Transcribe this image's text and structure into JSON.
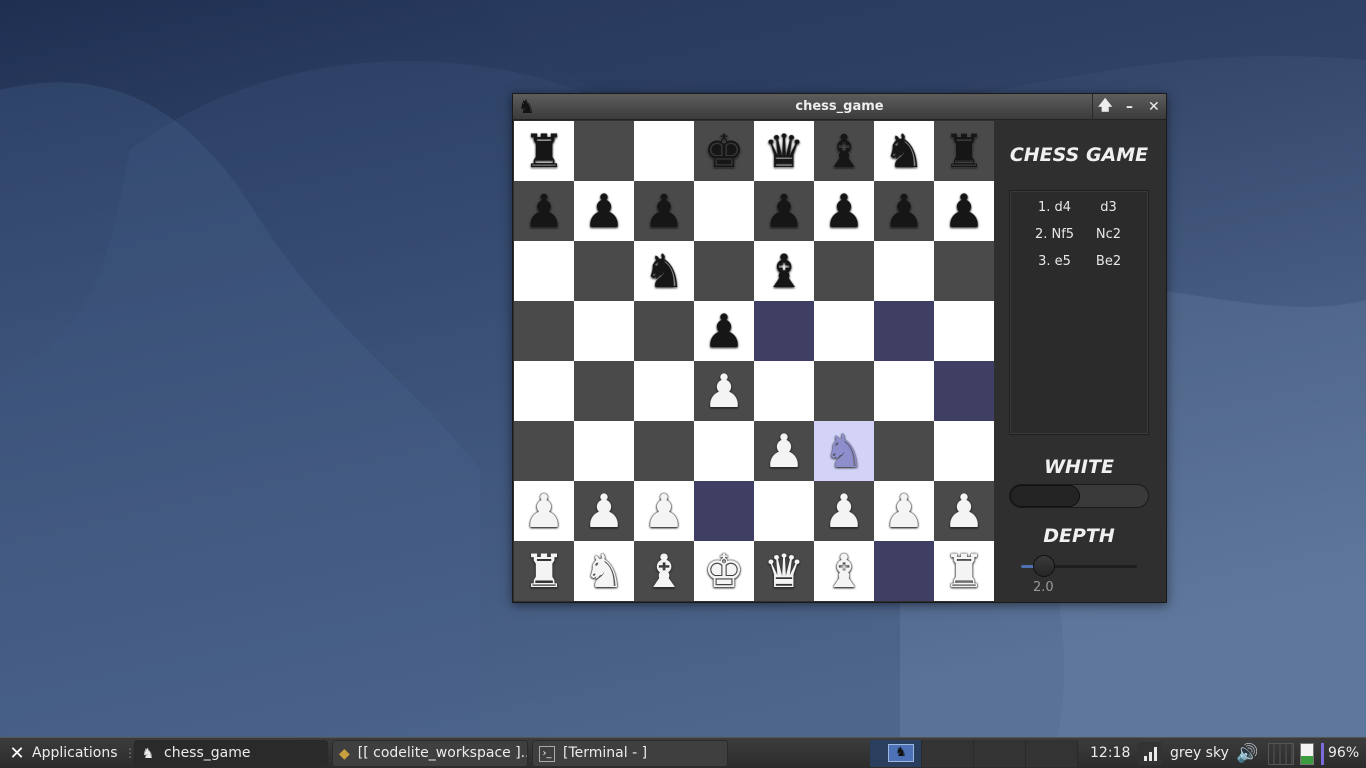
{
  "window": {
    "title": "chess_game",
    "buttons": {
      "maximize": "🡅",
      "minimize": "–",
      "close": "✕"
    }
  },
  "board": {
    "rows": [
      [
        {
          "piece": "♜",
          "color": "b",
          "bg": "light"
        },
        {
          "piece": "",
          "color": "",
          "bg": "dark"
        },
        {
          "piece": "",
          "color": "",
          "bg": "light"
        },
        {
          "piece": "♚",
          "color": "b",
          "bg": "dark"
        },
        {
          "piece": "♛",
          "color": "b",
          "bg": "light"
        },
        {
          "piece": "♝",
          "color": "b",
          "bg": "dark"
        },
        {
          "piece": "♞",
          "color": "b",
          "bg": "light"
        },
        {
          "piece": "♜",
          "color": "b",
          "bg": "dark"
        }
      ],
      [
        {
          "piece": "♟",
          "color": "b",
          "bg": "dark"
        },
        {
          "piece": "♟",
          "color": "b",
          "bg": "light"
        },
        {
          "piece": "♟",
          "color": "b",
          "bg": "dark"
        },
        {
          "piece": "",
          "color": "",
          "bg": "light"
        },
        {
          "piece": "♟",
          "color": "b",
          "bg": "dark"
        },
        {
          "piece": "♟",
          "color": "b",
          "bg": "light"
        },
        {
          "piece": "♟",
          "color": "b",
          "bg": "dark"
        },
        {
          "piece": "♟",
          "color": "b",
          "bg": "light"
        }
      ],
      [
        {
          "piece": "",
          "color": "",
          "bg": "light"
        },
        {
          "piece": "",
          "color": "",
          "bg": "dark"
        },
        {
          "piece": "♞",
          "color": "b",
          "bg": "light"
        },
        {
          "piece": "",
          "color": "",
          "bg": "dark"
        },
        {
          "piece": "♝",
          "color": "b",
          "bg": "light"
        },
        {
          "piece": "",
          "color": "",
          "bg": "dark"
        },
        {
          "piece": "",
          "color": "",
          "bg": "light"
        },
        {
          "piece": "",
          "color": "",
          "bg": "dark"
        }
      ],
      [
        {
          "piece": "",
          "color": "",
          "bg": "dark"
        },
        {
          "piece": "",
          "color": "",
          "bg": "light"
        },
        {
          "piece": "",
          "color": "",
          "bg": "dark"
        },
        {
          "piece": "♟",
          "color": "b",
          "bg": "light"
        },
        {
          "piece": "",
          "color": "",
          "bg": "hl"
        },
        {
          "piece": "",
          "color": "",
          "bg": "light"
        },
        {
          "piece": "",
          "color": "",
          "bg": "hl"
        },
        {
          "piece": "",
          "color": "",
          "bg": "light"
        }
      ],
      [
        {
          "piece": "",
          "color": "",
          "bg": "light"
        },
        {
          "piece": "",
          "color": "",
          "bg": "dark"
        },
        {
          "piece": "",
          "color": "",
          "bg": "light"
        },
        {
          "piece": "♟",
          "color": "w",
          "bg": "dark"
        },
        {
          "piece": "",
          "color": "",
          "bg": "light"
        },
        {
          "piece": "",
          "color": "",
          "bg": "dark"
        },
        {
          "piece": "",
          "color": "",
          "bg": "light"
        },
        {
          "piece": "",
          "color": "",
          "bg": "hl"
        }
      ],
      [
        {
          "piece": "",
          "color": "",
          "bg": "dark"
        },
        {
          "piece": "",
          "color": "",
          "bg": "light"
        },
        {
          "piece": "",
          "color": "",
          "bg": "dark"
        },
        {
          "piece": "",
          "color": "",
          "bg": "light"
        },
        {
          "piece": "♟",
          "color": "w",
          "bg": "dark"
        },
        {
          "piece": "♞",
          "color": "selw",
          "bg": "sel"
        },
        {
          "piece": "",
          "color": "",
          "bg": "dark"
        },
        {
          "piece": "",
          "color": "",
          "bg": "light"
        }
      ],
      [
        {
          "piece": "♟",
          "color": "w",
          "bg": "light"
        },
        {
          "piece": "♟",
          "color": "w",
          "bg": "dark"
        },
        {
          "piece": "♟",
          "color": "w",
          "bg": "light"
        },
        {
          "piece": "",
          "color": "",
          "bg": "hl"
        },
        {
          "piece": "",
          "color": "",
          "bg": "light"
        },
        {
          "piece": "♟",
          "color": "w",
          "bg": "dark"
        },
        {
          "piece": "♟",
          "color": "w",
          "bg": "light"
        },
        {
          "piece": "♟",
          "color": "w",
          "bg": "dark"
        }
      ],
      [
        {
          "piece": "♜",
          "color": "w",
          "bg": "dark"
        },
        {
          "piece": "♞",
          "color": "w",
          "bg": "light"
        },
        {
          "piece": "♝",
          "color": "w",
          "bg": "dark"
        },
        {
          "piece": "♚",
          "color": "w",
          "bg": "light"
        },
        {
          "piece": "♛",
          "color": "w",
          "bg": "dark"
        },
        {
          "piece": "♝",
          "color": "w",
          "bg": "light"
        },
        {
          "piece": "",
          "color": "",
          "bg": "hl"
        },
        {
          "piece": "♜",
          "color": "w",
          "bg": "light"
        }
      ]
    ]
  },
  "panel": {
    "title": "CHESS GAME",
    "moves": [
      {
        "white": "1. d4",
        "black": "d3"
      },
      {
        "white": "2. Nf5",
        "black": "Nc2"
      },
      {
        "white": "3. e5",
        "black": "Be2"
      }
    ],
    "turn_label": "WHITE",
    "toggle_state": "off",
    "depth_label": "DEPTH",
    "depth_value": "2.0",
    "depth_fraction": 0.2
  },
  "taskbar": {
    "applications_label": "Applications",
    "applications_icon": "xfce-mouse-icon",
    "tasks": [
      {
        "label": "chess_game",
        "icon": "chess-knight-icon",
        "active": true
      },
      {
        "label": "[[ codelite_workspace ]...",
        "icon": "codelite-icon",
        "active": false
      },
      {
        "label": "[Terminal - ]",
        "icon": "terminal-icon",
        "active": false
      }
    ],
    "clock": "12:18",
    "weather": "grey sky",
    "battery": "96%",
    "colors": {
      "accent": "#4d71b6",
      "highlight_square": "#3f3f63",
      "selected_square": "#d3d3f7"
    }
  }
}
